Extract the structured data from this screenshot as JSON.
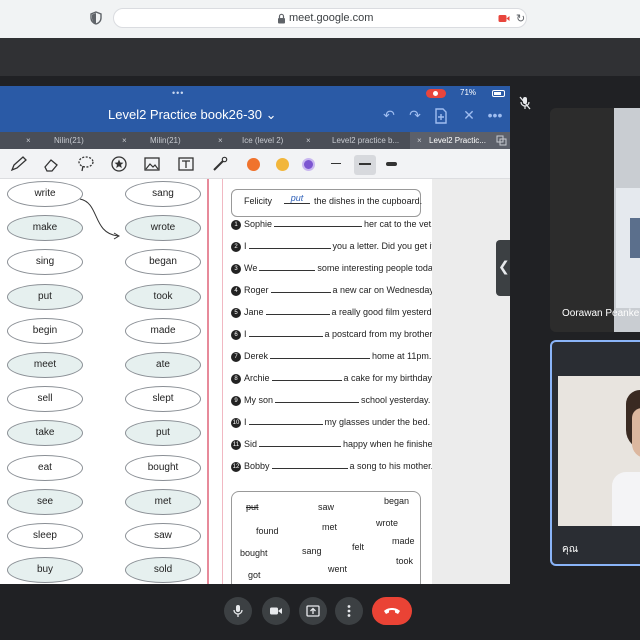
{
  "browser": {
    "url": "meet.google.com"
  },
  "tablet": {
    "status_dots": "•••",
    "status_right": "71%",
    "doc_title": "Level2 Practice book26-30",
    "title_caret": "⌄",
    "tabs": [
      {
        "label": "Nilin(21)"
      },
      {
        "label": "Milin(21)"
      },
      {
        "label": "Ice (level 2)"
      },
      {
        "label": "Level2 practice b..."
      },
      {
        "label": "Level2 Practic..."
      }
    ],
    "tab_close": "×",
    "colors": {
      "header": "#2a5aa6",
      "orange": "#f0732d",
      "yellow": "#f2b63b",
      "purple": "#7c55d1"
    }
  },
  "worksheet": {
    "left_words": [
      "write",
      "make",
      "sing",
      "put",
      "begin",
      "meet",
      "sell",
      "take",
      "eat",
      "see",
      "sleep",
      "buy"
    ],
    "right_words": [
      "sang",
      "wrote",
      "began",
      "took",
      "made",
      "ate",
      "slept",
      "put",
      "bought",
      "met",
      "saw",
      "sold"
    ],
    "example": {
      "name": "Felicity",
      "answer": "put",
      "rest": "the dishes in the cupboard."
    },
    "sentences": [
      {
        "n": "1",
        "pre": "Sophie",
        "post": "her cat to the vet."
      },
      {
        "n": "2",
        "pre": "I",
        "post": "you a letter. Did you get it?"
      },
      {
        "n": "3",
        "pre": "We",
        "post": "some interesting people today."
      },
      {
        "n": "4",
        "pre": "Roger",
        "post": "a new car on Wednesday."
      },
      {
        "n": "5",
        "pre": "Jane",
        "post": "a really good film yesterday."
      },
      {
        "n": "6",
        "pre": "I",
        "post": "a postcard from my brother."
      },
      {
        "n": "7",
        "pre": "Derek",
        "post": "home at 11pm."
      },
      {
        "n": "8",
        "pre": "Archie",
        "post": "a cake for my birthday."
      },
      {
        "n": "9",
        "pre": "My son",
        "post": "school yesterday."
      },
      {
        "n": "10",
        "pre": "I",
        "post": "my glasses under the bed."
      },
      {
        "n": "11",
        "pre": "Sid",
        "post": "happy when he finished school."
      },
      {
        "n": "12",
        "pre": "Bobby",
        "post": "a song to his mother."
      }
    ],
    "word_box": [
      "put",
      "saw",
      "began",
      "found",
      "met",
      "wrote",
      "bought",
      "sang",
      "felt",
      "made",
      "got",
      "went",
      "took"
    ]
  },
  "participants": [
    {
      "name": "Oorawan Peanke"
    },
    {
      "name": "คุณ"
    }
  ],
  "handle_glyph": "❮"
}
